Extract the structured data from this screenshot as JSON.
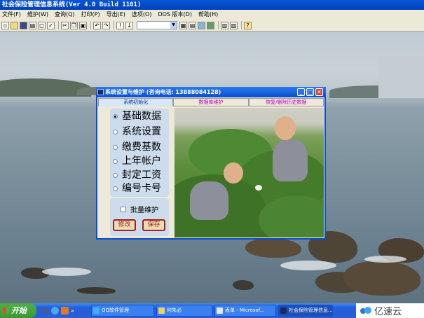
{
  "app": {
    "title": "社会保险管理信息系统(Ver 4.0 Build 1101)",
    "menu": [
      "文件(F)",
      "维护(W)",
      "查询(Q)",
      "打印(P)",
      "导出(E)",
      "选项(O)",
      "DOS 版本(D)",
      "帮助(H)"
    ]
  },
  "toolbar": {
    "buttons": [
      "new-icon",
      "open-icon",
      "save-icon",
      "print-icon",
      "preview-icon",
      "spellcheck-icon",
      "cut-icon",
      "copy-icon",
      "paste-icon",
      "undo-icon",
      "redo-icon",
      "exclaim-icon",
      "insert-icon",
      "table-icon",
      "report-icon",
      "image-icon",
      "camera-icon",
      "grid-icon",
      "chart-icon",
      "help-icon"
    ],
    "select_value": ""
  },
  "dialog": {
    "title": "系统设置与维护 (咨询电话: 13888084128)",
    "tabs": [
      "系统初始化",
      "数据库维护",
      "恢复/删除历史数据"
    ],
    "options": [
      "基础数据",
      "系统设置",
      "缴费基数",
      "上年帐户",
      "封定工资",
      "编号卡号"
    ],
    "selected_option_index": 0,
    "batch_label": "批量维护",
    "batch_checked": false,
    "buttons": {
      "modify": "修改",
      "save": "保存"
    }
  },
  "taskbar": {
    "start_label": "开始",
    "tasks": [
      "QQ软件管理",
      "何朱必",
      "表单 - Microsof...",
      "社会保险管理信息..."
    ],
    "active_task_index": 3
  },
  "watermark": {
    "text": "亿速云"
  }
}
